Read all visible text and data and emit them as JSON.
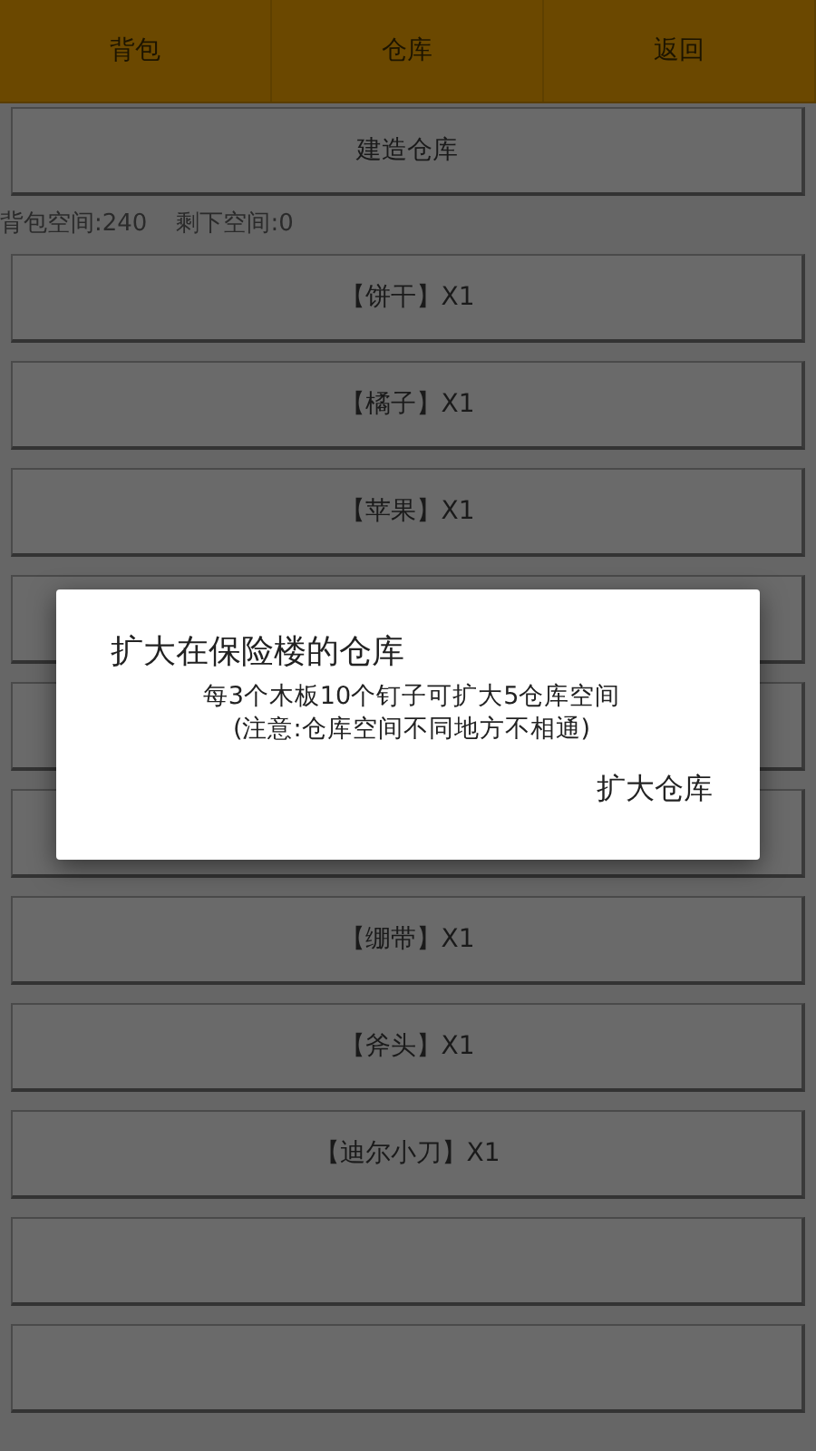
{
  "tabs": [
    {
      "label": "背包"
    },
    {
      "label": "仓库"
    },
    {
      "label": "返回"
    }
  ],
  "build_button": "建造仓库",
  "stats": {
    "bag_space": "背包空间:240",
    "remaining_space": "剩下空间:0"
  },
  "items": [
    {
      "kind": "item",
      "label": "【饼干】X1"
    },
    {
      "kind": "item",
      "label": "【橘子】X1"
    },
    {
      "kind": "item",
      "label": "【苹果】X1"
    },
    {
      "kind": "blank"
    },
    {
      "kind": "blank"
    },
    {
      "kind": "blank"
    },
    {
      "kind": "item",
      "label": "【绷带】X1"
    },
    {
      "kind": "item",
      "label": "【斧头】X1"
    },
    {
      "kind": "item",
      "label": "【迪尔小刀】X1"
    },
    {
      "kind": "blank"
    },
    {
      "kind": "blank"
    }
  ],
  "dialog": {
    "title": "扩大在保险楼的仓库",
    "message": [
      "每3个木板10个钉子可扩大5仓库空间",
      "(注意:仓库空间不同地方不相通)"
    ],
    "action": "扩大仓库"
  }
}
